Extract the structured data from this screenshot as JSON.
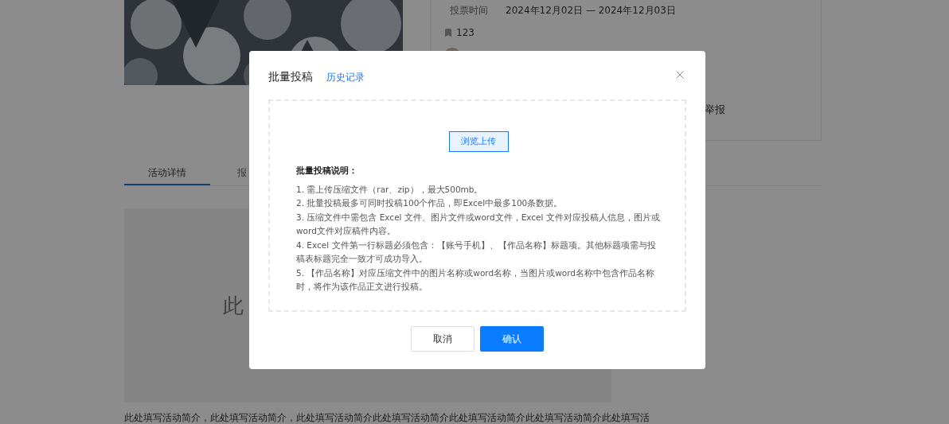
{
  "page": {
    "info": {
      "vote_time_label": "投票时间",
      "vote_time_value": "2024年12月02日 — 2024年12月03日",
      "bookmark_count": "123",
      "report": "举报"
    },
    "tabs": [
      {
        "label": "活动详情",
        "selected": true
      },
      {
        "label": "报",
        "selected": false
      }
    ],
    "banner_text": "此",
    "intro": "此处填写活动简介，此处填写活动简介，此处填写活动简介此处填写活动简介此处填写活动简介此处填写活动简介此处填写活"
  },
  "dialog": {
    "title": "批量投稿",
    "history_link": "历史记录",
    "upload_button": "浏览上传",
    "instructions_title": "批量投稿说明：",
    "instructions": [
      "1. 需上传压缩文件（rar、zip），最大500mb。",
      "2. 批量投稿最多可同时投稿100个作品，即Excel中最多100条数据。",
      "3. 压缩文件中需包含 Excel 文件、图片文件或word文件，Excel 文件对应投稿人信息，图片或word文件对应稿件内容。",
      "4. Excel 文件第一行标题必须包含：【账号手机】、【作品名称】标题项。其他标题项需与投稿表标题完全一致才可成功导入。",
      "5. 【作品名称】对应压缩文件中的图片名称或word名称，当图片或word名称中包含作品名称时，将作为该作品正文进行投稿。"
    ],
    "buttons": [
      {
        "label": "取消",
        "kind": "secondary"
      },
      {
        "label": "确认",
        "kind": "primary"
      }
    ]
  }
}
